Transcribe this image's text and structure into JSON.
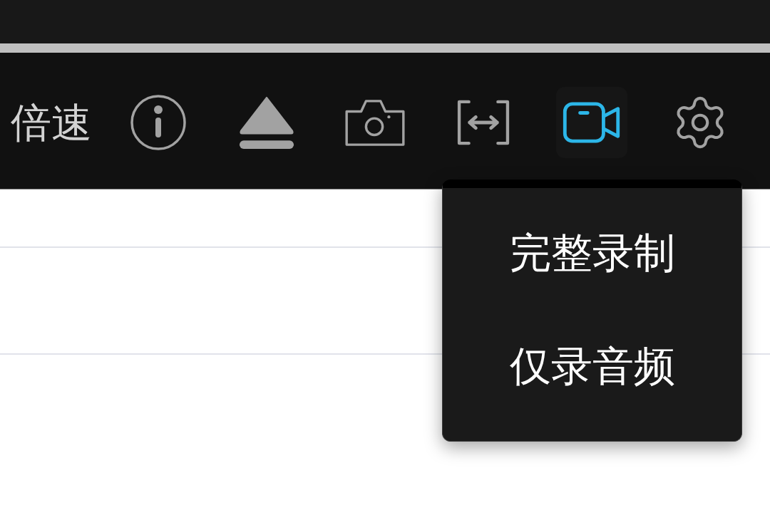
{
  "toolbar": {
    "speed_label": "倍速",
    "buttons": [
      {
        "kind": "info",
        "selected": false
      },
      {
        "kind": "eject",
        "selected": false
      },
      {
        "kind": "screenshot",
        "selected": false
      },
      {
        "kind": "fit_width",
        "selected": false
      },
      {
        "kind": "record",
        "selected": true
      },
      {
        "kind": "settings",
        "selected": false
      }
    ]
  },
  "record_menu": {
    "items": [
      {
        "label": "完整录制"
      },
      {
        "label": "仅录音频"
      }
    ]
  }
}
